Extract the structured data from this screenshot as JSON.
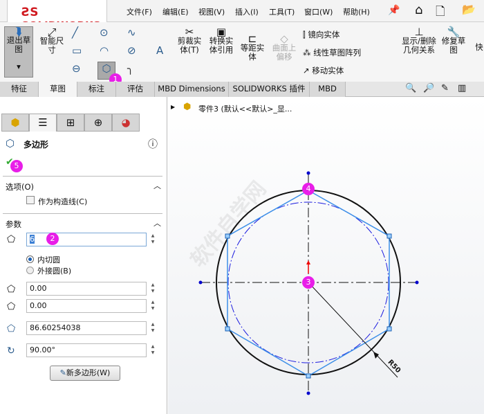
{
  "app": {
    "logo": "SOLIDWORKS"
  },
  "menu": [
    "文件(F)",
    "编辑(E)",
    "视图(V)",
    "插入(I)",
    "工具(T)",
    "窗口(W)",
    "帮助(H)"
  ],
  "ribbon": {
    "exit_sketch": "退出草图",
    "smart_dim": "智能尺寸",
    "trim": "剪裁实体(T)",
    "convert": "转换实体引用",
    "offset": "等距实体",
    "surface_offset": "曲面上偏移",
    "mirror": "镜向实体",
    "linear_pattern": "线性草图阵列",
    "move": "移动实体",
    "show_relations": "显示/删除几何关系",
    "repair": "修复草图",
    "quick": "快"
  },
  "tabs": [
    "特征",
    "草图",
    "标注",
    "评估",
    "MBD Dimensions",
    "SOLIDWORKS 插件",
    "MBD"
  ],
  "active_tab": "草图",
  "tree": {
    "part": "零件3 (默认<<默认>_显..."
  },
  "panel": {
    "title": "多边形",
    "options_header": "选项(O)",
    "construction": "作为构造线(C)",
    "params_header": "参数",
    "sides": "6",
    "inscribed": "内切圆",
    "circumscribed": "外接圆(B)",
    "x": "0.00",
    "y": "0.00",
    "diameter": "86.60254038",
    "angle": "90.00°",
    "new_polygon": "新多边形(W)"
  },
  "badges": [
    "1",
    "2",
    "3",
    "4",
    "5"
  ],
  "drawing": {
    "dimension": "R50",
    "watermark": "软件自学网"
  }
}
